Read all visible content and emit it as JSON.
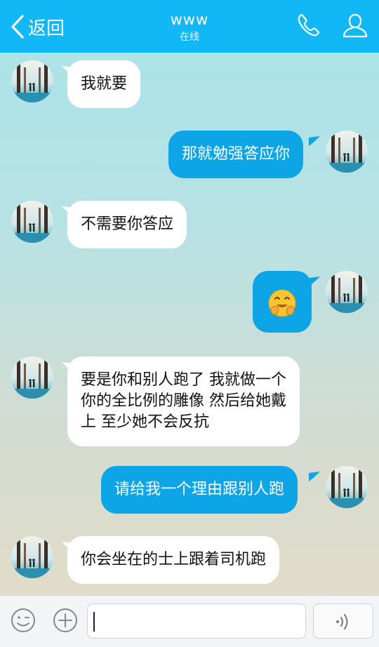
{
  "header": {
    "back_label": "返回",
    "title": "www",
    "status": "在线"
  },
  "messages": [
    {
      "side": "left",
      "text": "我就要"
    },
    {
      "side": "right",
      "text": "那就勉强答应你"
    },
    {
      "side": "left",
      "text": "不需要你答应"
    },
    {
      "side": "right",
      "emoji": "🤗"
    },
    {
      "side": "left",
      "text": "要是你和别人跑了 我就做一个\n你的全比例的雕像 然后给她戴\n上 至少她不会反抗"
    },
    {
      "side": "right",
      "text": "请给我一个理由跟别人跑"
    },
    {
      "side": "left",
      "text": "你会坐在的士上跟着司机跑"
    }
  ],
  "input": {
    "value": ""
  },
  "colors": {
    "header_bg": "#12b7f5",
    "outgoing_bubble": "#0ea5e6",
    "incoming_bubble": "#ffffff"
  }
}
